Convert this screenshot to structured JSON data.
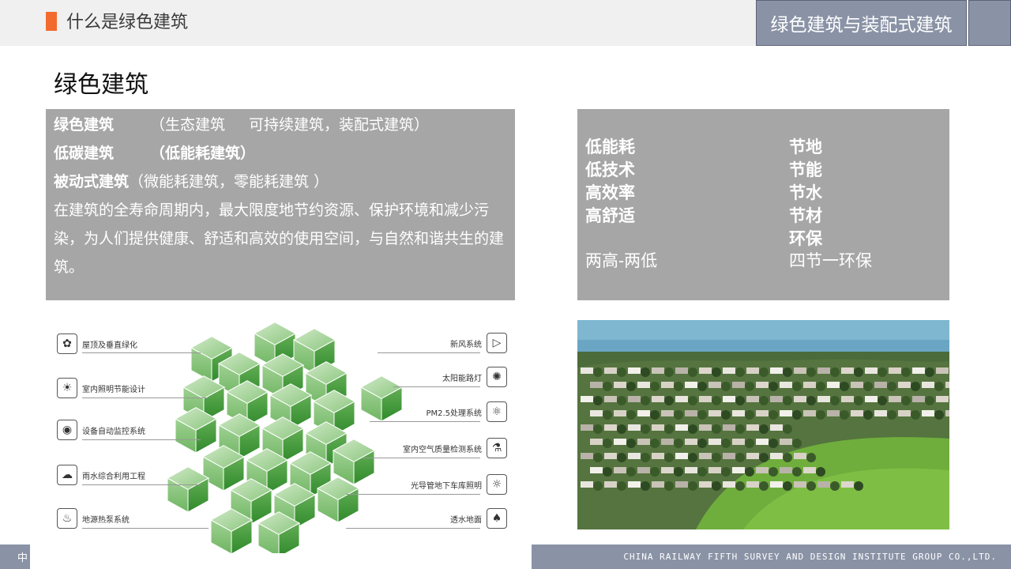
{
  "header": {
    "section_title": "什么是绿色建筑",
    "badge_label": "绿色建筑与装配式建筑"
  },
  "heading": "绿色建筑",
  "left_panel": {
    "row1_term": "绿色建筑",
    "row1_a": "（生态建筑",
    "row1_b": "可持续建筑，装配式建筑）",
    "row2_term": "低碳建筑",
    "row2_detail": "（低能耗建筑）",
    "row3_term": "被动式建筑",
    "row3_detail": "（微能耗建筑，零能耗建筑  ）",
    "definition": "在建筑的全寿命周期内，最大限度地节约资源、保护环境和减少污染，为人们提供健康、舒适和高效的使用空间，与自然和谐共生的建筑。"
  },
  "right_panel": {
    "left_items": [
      "低能耗",
      "低技术",
      "高效率",
      "高舒适"
    ],
    "left_summary": "两高-两低",
    "right_items": [
      "节地",
      "节能",
      "节水",
      "节材",
      "环保"
    ],
    "right_summary": "四节一环保"
  },
  "diagram": {
    "left_features": [
      {
        "label": "屋顶及垂直绿化",
        "icon": "plant-icon"
      },
      {
        "label": "室内照明节能设计",
        "icon": "bulb-icon"
      },
      {
        "label": "设备自动监控系统",
        "icon": "camera-icon"
      },
      {
        "label": "雨水综合利用工程",
        "icon": "rain-cloud-icon"
      },
      {
        "label": "地源热泵系统",
        "icon": "thermometer-icon"
      }
    ],
    "right_features": [
      {
        "label": "新风系统",
        "icon": "fan-icon"
      },
      {
        "label": "太阳能路灯",
        "icon": "solar-icon"
      },
      {
        "label": "PM2.5处理系统",
        "icon": "atom-icon"
      },
      {
        "label": "室内空气质量检测系统",
        "icon": "flask-icon"
      },
      {
        "label": "光导管地下车库照明",
        "icon": "sun-icon"
      },
      {
        "label": "透水地面",
        "icon": "water-drop-icon"
      }
    ]
  },
  "footer": {
    "left_text": "中",
    "company": "CHINA RAILWAY FIFTH SURVEY AND DESIGN INSTITUTE GROUP CO.,LTD."
  },
  "colors": {
    "accent": "#f26a2e",
    "panel_grey": "#a6a6a6",
    "brand_slate": "#8a93a6",
    "cube_green": "#3f9a3a"
  }
}
